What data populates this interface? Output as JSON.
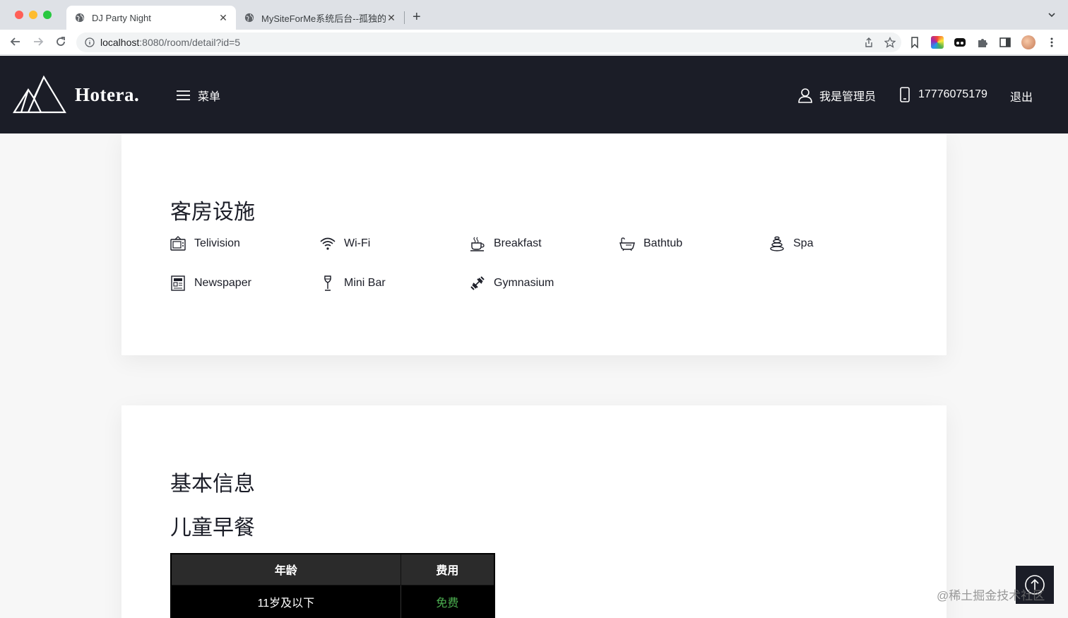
{
  "browser": {
    "tabs": [
      {
        "title": "DJ Party Night",
        "active": true
      },
      {
        "title": "MySiteForMe系统后台--孤独的",
        "active": false
      }
    ],
    "url_host": "localhost",
    "url_rest": ":8080/room/detail?id=5"
  },
  "header": {
    "logo_text": "Hotera.",
    "menu_label": "菜单",
    "user_label": "我是管理员",
    "phone": "17776075179",
    "logout_label": "退出"
  },
  "facilities": {
    "title": "客房设施",
    "items": [
      {
        "label": "Telivision",
        "icon": "tv-icon"
      },
      {
        "label": "Wi-Fi",
        "icon": "wifi-icon"
      },
      {
        "label": "Breakfast",
        "icon": "coffee-icon"
      },
      {
        "label": "Bathtub",
        "icon": "bathtub-icon"
      },
      {
        "label": "Spa",
        "icon": "spa-stones-icon"
      },
      {
        "label": "Newspaper",
        "icon": "newspaper-icon"
      },
      {
        "label": "Mini Bar",
        "icon": "wine-glass-icon"
      },
      {
        "label": "Gymnasium",
        "icon": "dumbbell-icon"
      }
    ]
  },
  "basic_info": {
    "title": "基本信息",
    "kids_breakfast_title": "儿童早餐",
    "table": {
      "headers": [
        "年龄",
        "费用"
      ],
      "rows": [
        [
          "11岁及以下",
          "免费"
        ]
      ]
    }
  },
  "watermark": "@稀土掘金技术社区",
  "colors": {
    "header_bg": "#1b1d27",
    "free_text": "#4caf50"
  }
}
